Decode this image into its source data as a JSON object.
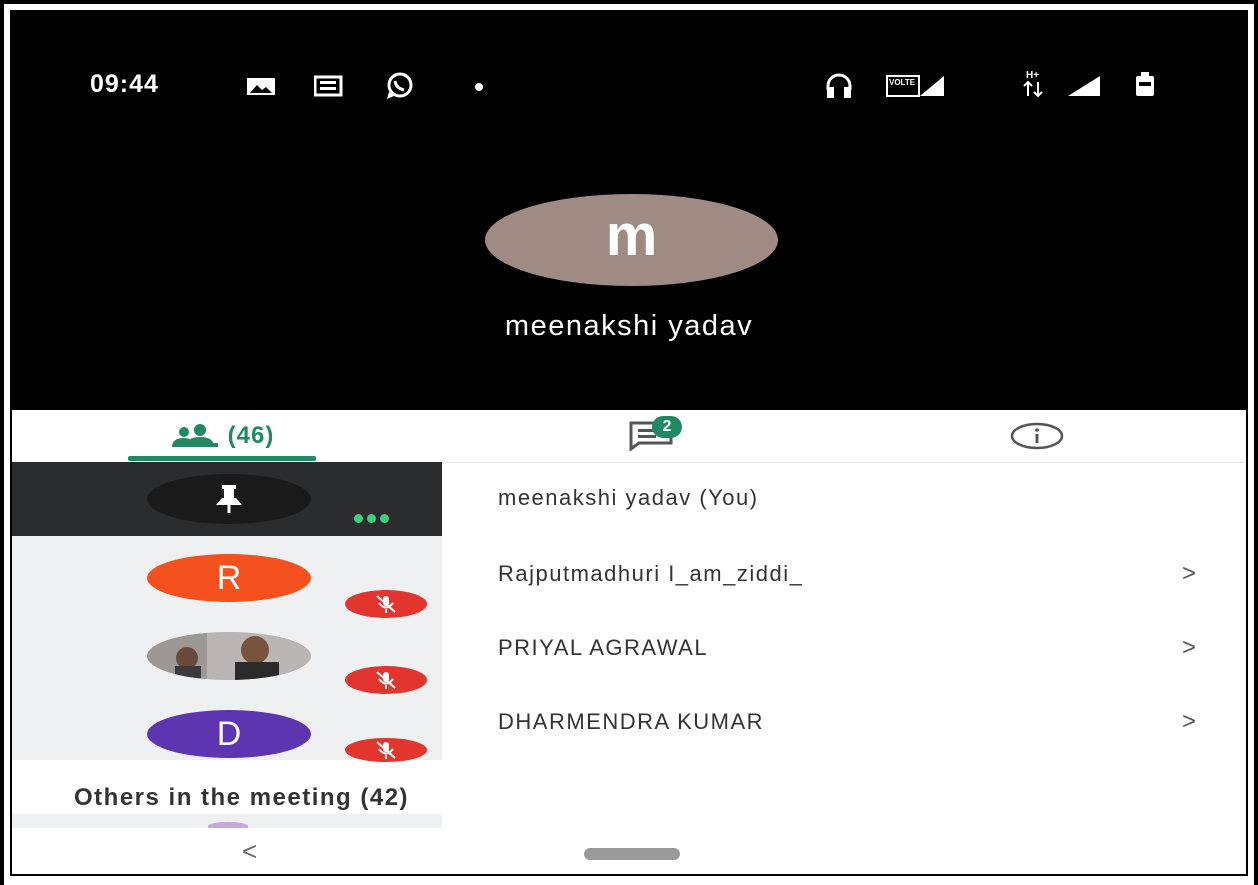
{
  "status_bar": {
    "time": "09:44",
    "left_icons": [
      "image-icon",
      "news-icon",
      "whatsapp-icon",
      "dot-icon"
    ],
    "right_icons": [
      "headphones-icon",
      "volte-icon",
      "signal-icon",
      "data-arrows-icon",
      "signal-icon",
      "battery-icon"
    ],
    "volte_text": "VOLTE",
    "data_text": "H+"
  },
  "speaker": {
    "initial": "m",
    "name": "meenakshi yadav",
    "avatar_color": "#a08a84"
  },
  "tabs": {
    "people_count": "(46)",
    "chat_badge": "2",
    "accent": "#1f8a62"
  },
  "participants": [
    {
      "name": "meenakshi yadav (You)",
      "avatar": "pin",
      "muted": false,
      "chevron": ""
    },
    {
      "name": "Rajputmadhuri I_am_ziddi_",
      "initial": "R",
      "color": "#f4511e",
      "muted": true,
      "chevron": ">"
    },
    {
      "name": "PRIYAL AGRAWAL",
      "avatar": "photo",
      "muted": true,
      "chevron": ">"
    },
    {
      "name": "DHARMENDRA KUMAR",
      "initial": "D",
      "color": "#5e35b1",
      "muted": true,
      "chevron": ">"
    }
  ],
  "others_label": "Others in the meeting (42)",
  "nav": {
    "back": "<"
  },
  "colors": {
    "mute_badge": "#e2352d",
    "more_dots": "#3fd07f"
  }
}
